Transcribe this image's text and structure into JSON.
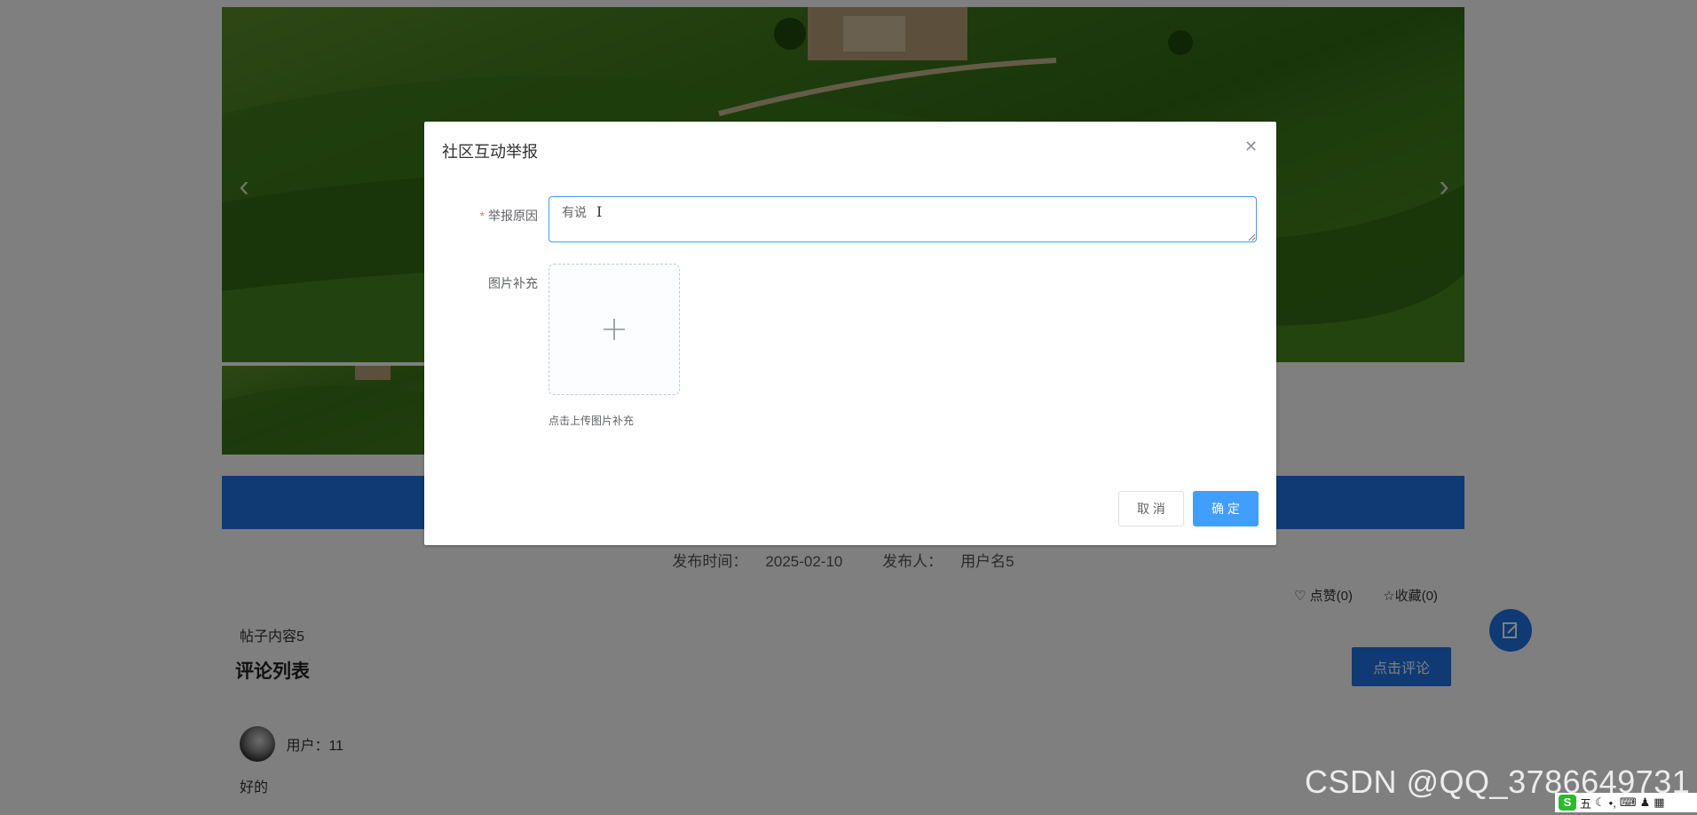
{
  "post": {
    "meta_time_label": "发布时间：",
    "meta_time": "2025-02-10",
    "meta_author_label": "发布人：",
    "meta_author": "用户名5",
    "like_label": "点赞(0)",
    "favorite_label": "收藏(0)",
    "content": "帖子内容5"
  },
  "comments": {
    "title": "评论列表",
    "comment_button": "点击评论",
    "items": [
      {
        "user": "用户：11",
        "text": "好的"
      }
    ]
  },
  "watermark": "CSDN @QQ_3786649731",
  "tray": {
    "ime": "五"
  },
  "dialog": {
    "title": "社区互动举报",
    "close_icon": "close-icon",
    "reason_label": "举报原因",
    "reason_required_mark": "*",
    "reason_value": "有说",
    "image_label": "图片补充",
    "upload_tip": "点击上传图片补充",
    "cancel_label": "取 消",
    "confirm_label": "确 定"
  },
  "colors": {
    "primary": "#1f74e8",
    "dialog_primary": "#409eff",
    "required": "#f56c6c"
  }
}
